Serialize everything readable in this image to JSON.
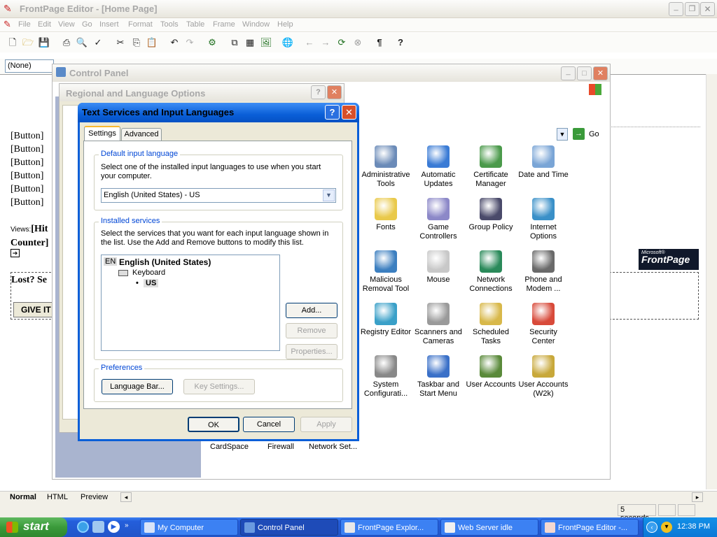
{
  "frontpage": {
    "title": "FrontPage Editor - [Home Page]",
    "menu": [
      "File",
      "Edit",
      "View",
      "Go",
      "Insert",
      "Format",
      "Tools",
      "Table",
      "Frame",
      "Window",
      "Help"
    ],
    "style_select": "(None)",
    "page_buttons": [
      "[Button]",
      "[Button]",
      "[Button]",
      "[Button]",
      "[Button]",
      "[Button]"
    ],
    "views_label": "Views:",
    "hit_counter_1": "[Hit",
    "hit_counter_2": "Counter]",
    "lost_text": "Lost? Se",
    "give_button": "GIVE IT",
    "badge_small": "Microsoft®",
    "badge_big": "FrontPage",
    "tabs": [
      "Normal",
      "HTML",
      "Preview"
    ],
    "status_time": "5 seconds"
  },
  "control_panel": {
    "title": "Control Panel",
    "go_label": "Go",
    "items": [
      {
        "label": "Administrative Tools",
        "icon": "admin-tools-icon",
        "color": "#6b8bb8"
      },
      {
        "label": "Automatic Updates",
        "icon": "windows-update-icon",
        "color": "#3a7bd5"
      },
      {
        "label": "Certificate Manager",
        "icon": "certificate-icon",
        "color": "#4b9a4b"
      },
      {
        "label": "Date and Time",
        "icon": "clock-icon",
        "color": "#7aa5d6"
      },
      {
        "label": "Fonts",
        "icon": "fonts-folder-icon",
        "color": "#e9c94a"
      },
      {
        "label": "Game Controllers",
        "icon": "gamepad-icon",
        "color": "#8c88c8"
      },
      {
        "label": "Group Policy",
        "icon": "group-policy-icon",
        "color": "#4a4a6a"
      },
      {
        "label": "Internet Options",
        "icon": "globe-icon",
        "color": "#3a90c8"
      },
      {
        "label": "Malicious Removal Tool",
        "icon": "monitor-shield-icon",
        "color": "#3c7fc0"
      },
      {
        "label": "Mouse",
        "icon": "mouse-icon",
        "color": "#c8c8c8"
      },
      {
        "label": "Network Connections",
        "icon": "network-globe-icon",
        "color": "#2a8a5a"
      },
      {
        "label": "Phone and Modem ...",
        "icon": "phone-icon",
        "color": "#6a6a6a"
      },
      {
        "label": "Registry Editor",
        "icon": "registry-icon",
        "color": "#3aa0c8"
      },
      {
        "label": "Scanners and Cameras",
        "icon": "scanner-icon",
        "color": "#9a9a9a"
      },
      {
        "label": "Scheduled Tasks",
        "icon": "scheduled-tasks-icon",
        "color": "#d8b84a"
      },
      {
        "label": "Security Center",
        "icon": "security-shield-icon",
        "color": "#d84a3a"
      },
      {
        "label": "System Configurati...",
        "icon": "system-config-icon",
        "color": "#888888"
      },
      {
        "label": "Taskbar and Start Menu",
        "icon": "taskbar-icon",
        "color": "#3a70c8"
      },
      {
        "label": "User Accounts",
        "icon": "users-icon",
        "color": "#5a8a3a"
      },
      {
        "label": "User Accounts (W2k)",
        "icon": "users-key-icon",
        "color": "#c8a83a"
      }
    ],
    "bottom_labels": [
      "CardSpace",
      "Firewall",
      "Network Set..."
    ]
  },
  "regional": {
    "title": "Regional and Language Options"
  },
  "dialog": {
    "title": "Text Services and Input Languages",
    "tabs": [
      "Settings",
      "Advanced"
    ],
    "default_group": "Default input language",
    "default_desc": "Select one of the installed input languages to use when you start your computer.",
    "default_value": "English (United States) - US",
    "installed_group": "Installed services",
    "installed_desc": "Select the services that you want for each input language shown in the list. Use the Add and Remove buttons to modify this list.",
    "lang_code": "EN",
    "lang_name": "English (United States)",
    "keyboard_label": "Keyboard",
    "layout_label": "US",
    "add": "Add...",
    "remove": "Remove",
    "properties": "Properties...",
    "prefs_group": "Preferences",
    "language_bar": "Language Bar...",
    "key_settings": "Key Settings...",
    "ok": "OK",
    "cancel": "Cancel",
    "apply": "Apply"
  },
  "taskbar": {
    "start": "start",
    "tasks": [
      "My Computer",
      "Control Panel",
      "FrontPage Explor...",
      "Web Server idle",
      "FrontPage Editor -..."
    ],
    "clock": "12:38 PM"
  },
  "colors": {
    "xp_blue": "#0a5fd8",
    "taskbar": "#245edb",
    "start_green": "#3a9a3a"
  }
}
